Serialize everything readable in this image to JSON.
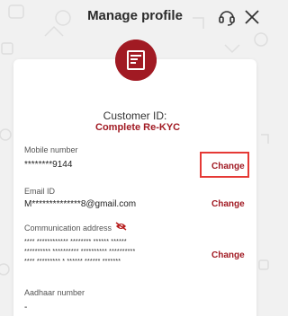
{
  "header": {
    "title": "Manage profile",
    "support_icon": "headset-icon",
    "close_icon": "close-icon"
  },
  "profile_card": {
    "logo_icon": "brand-logo-icon",
    "customer_id_label": "Customer ID:",
    "kyc_link": "Complete Re-KYC",
    "fields": [
      {
        "label": "Mobile number",
        "value": "********9144",
        "action": "Change"
      },
      {
        "label": "Email ID",
        "value": "M**************8@gmail.com",
        "action": "Change"
      },
      {
        "label": "Communication address",
        "value_lines": [
          "**** ************ ******** ****** ******",
          "********** ********** ********** **********",
          "**** ********* * ****** ****** *******"
        ],
        "action": "Change",
        "visibility_icon": "eye-off-icon"
      },
      {
        "label": "Aadhaar number",
        "value": "-"
      }
    ]
  },
  "colors": {
    "brand": "#a11a23",
    "highlight": "#e53935",
    "background": "#f1f1f1"
  }
}
